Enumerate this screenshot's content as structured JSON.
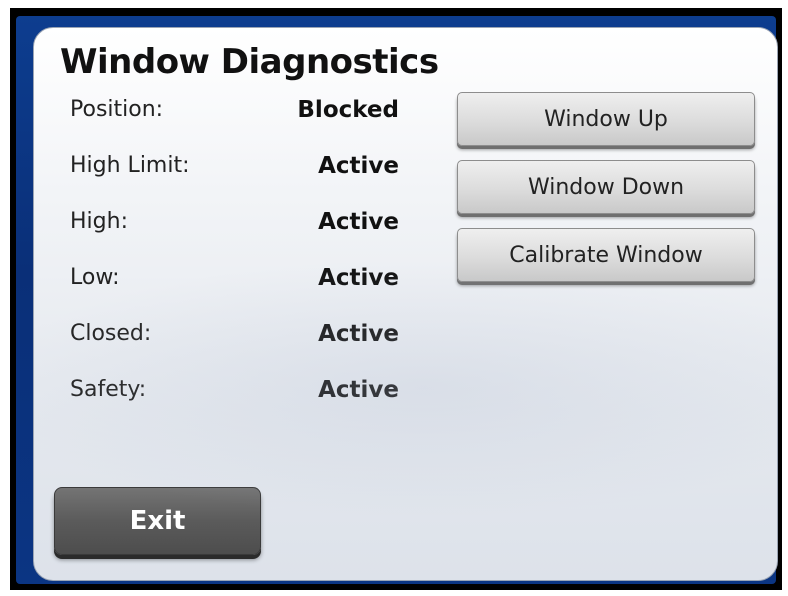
{
  "panel": {
    "title": "Window Diagnostics"
  },
  "status_rows": [
    {
      "label": "Position:",
      "value": "Blocked"
    },
    {
      "label": "High Limit:",
      "value": "Active"
    },
    {
      "label": "High:",
      "value": "Active"
    },
    {
      "label": "Low:",
      "value": "Active"
    },
    {
      "label": "Closed:",
      "value": "Active"
    },
    {
      "label": "Safety:",
      "value": "Active"
    }
  ],
  "actions": {
    "window_up": "Window Up",
    "window_down": "Window Down",
    "calibrate": "Calibrate Window"
  },
  "exit_label": "Exit",
  "colors": {
    "frame_blue": "#0b3583",
    "button_gray": "#dcdcdc",
    "exit_gray": "#5b5b5b"
  }
}
